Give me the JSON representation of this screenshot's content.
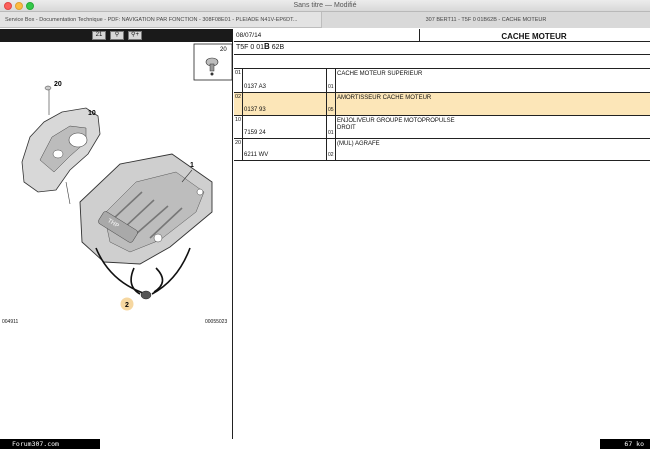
{
  "window": {
    "title": "Sans titre — Modifié"
  },
  "tabs": [
    {
      "label": "Service Box - Documentation Technique - PDF: NAVIGATION PAR FONCTION - 308F08E01 - PLEIADE N41V-EP6DT..."
    },
    {
      "label": "307 BERT11 - T5F 0 01B62B - CACHE MOTEUR"
    }
  ],
  "toolbar": {
    "btn1": "21",
    "btn2": "⚲",
    "btn3": "⚲+"
  },
  "diagram": {
    "callout_20_top": "20",
    "callout_20": "20",
    "callout_10": "10",
    "callout_1": "1",
    "callout_2": "2",
    "foot_left": "004911",
    "foot_right": "00055023"
  },
  "parts": {
    "date": "08/07/14",
    "ref_prefix": "T5F 0 01",
    "ref_bold": "B",
    "ref_suffix": " 62B",
    "title": "CACHE MOTEUR",
    "rows": [
      {
        "num": "01",
        "ref": "0137 A3",
        "qty": "01",
        "desc1": "CACHE MOTEUR SUPERIEUR",
        "desc2": ""
      },
      {
        "num": "02",
        "ref": "0137 93",
        "qty": "05",
        "desc1": "AMORTISSEUR CACHE MOTEUR",
        "desc2": ""
      },
      {
        "num": "10",
        "ref": "7159 24",
        "qty": "01",
        "desc1": "ENJOLIVEUR GROUPE MOTOPROPULSE",
        "desc2": "DROIT"
      },
      {
        "num": "20",
        "ref": "6211 WV",
        "qty": "02",
        "desc1": "(MUL) AGRAFE",
        "desc2": ""
      }
    ]
  },
  "footer": {
    "forum": "Forum307.com",
    "size": "67 ko"
  },
  "colors": {
    "highlight_row": "#fce6b8",
    "callout_marker": "#f6d7a0"
  }
}
